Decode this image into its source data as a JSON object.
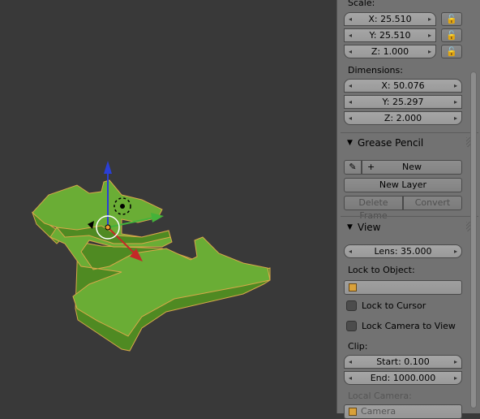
{
  "viewport": {
    "description_icons": [
      "transform-manipulator"
    ]
  },
  "panel": {
    "scale": {
      "label": "Scale:",
      "x": "X: 25.510",
      "y": "Y: 25.510",
      "z": "Z: 1.000"
    },
    "dimensions": {
      "label": "Dimensions:",
      "x": "X: 50.076",
      "y": "Y: 25.297",
      "z": "Z: 2.000"
    },
    "grease_pencil": {
      "title": "Grease Pencil",
      "new_label": "New",
      "new_layer": "New Layer",
      "delete_frame": "Delete Frame",
      "convert": "Convert"
    },
    "view": {
      "title": "View",
      "lens": "Lens: 35.000",
      "lock_to_object": "Lock to Object:",
      "lock_to_cursor": "Lock to Cursor",
      "lock_camera_to_view": "Lock Camera to View",
      "clip_label": "Clip:",
      "clip_start": "Start: 0.100",
      "clip_end": "End: 1000.000",
      "local_camera": "Local Camera:",
      "camera_value": "Camera"
    }
  },
  "colors": {
    "object": "#6aad35",
    "panel_bg": "#727272",
    "viewport_bg": "#393939"
  }
}
